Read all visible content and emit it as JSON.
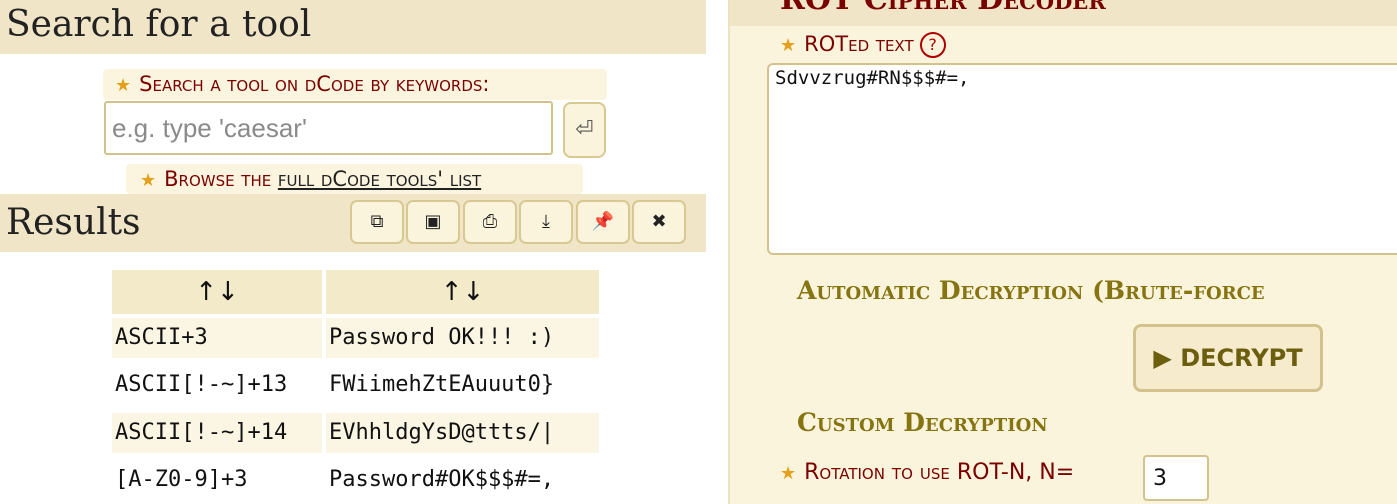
{
  "left": {
    "search_title": "Search for a tool",
    "search_label": "Search a tool on dCode by keywords:",
    "search_placeholder": "e.g. type 'caesar'",
    "enter_glyph": "⏎",
    "browse_prefix": "Browse the ",
    "browse_link": "full dCode tools' list",
    "results_title": "Results",
    "toolbar": [
      {
        "icon": "copy-icon",
        "glyph": "⧉"
      },
      {
        "icon": "screenshot-icon",
        "glyph": "▣"
      },
      {
        "icon": "print-icon",
        "glyph": "⎙"
      },
      {
        "icon": "download-icon",
        "glyph": "⤓"
      },
      {
        "icon": "pin-icon",
        "glyph": "📌"
      },
      {
        "icon": "close-icon",
        "glyph": "✖"
      }
    ],
    "table": {
      "headers": [
        "↑↓",
        "↑↓"
      ],
      "rows": [
        [
          "ASCII+3",
          "Password OK!!! :)"
        ],
        [
          "ASCII[!-~]+13",
          "FWiimehZtEAuuut0}"
        ],
        [
          "ASCII[!-~]+14",
          "EVhhldgYsD@ttts/|"
        ],
        [
          "[A-Z0-9]+3",
          "Password#OK$$$#=,"
        ]
      ]
    }
  },
  "right": {
    "title": "ROT Cipher Decoder",
    "roted_label": "ROTed text",
    "help": "?",
    "cipher_value": "Sdvvzrug#RN$$$#=,",
    "auto_heading": "Automatic Decryption (Brute-force",
    "decrypt_label": "▶ DECRYPT",
    "custom_heading": "Custom Decryption",
    "rotation_label": "Rotation to use ROT-N, N=",
    "rotation_value": "3"
  },
  "colors": {
    "header_bg": "#f0e6c7",
    "panel_bg": "#fbf4dd",
    "label_red": "#7a0000",
    "heading_olive": "#857410",
    "star": "#e3a01b"
  }
}
